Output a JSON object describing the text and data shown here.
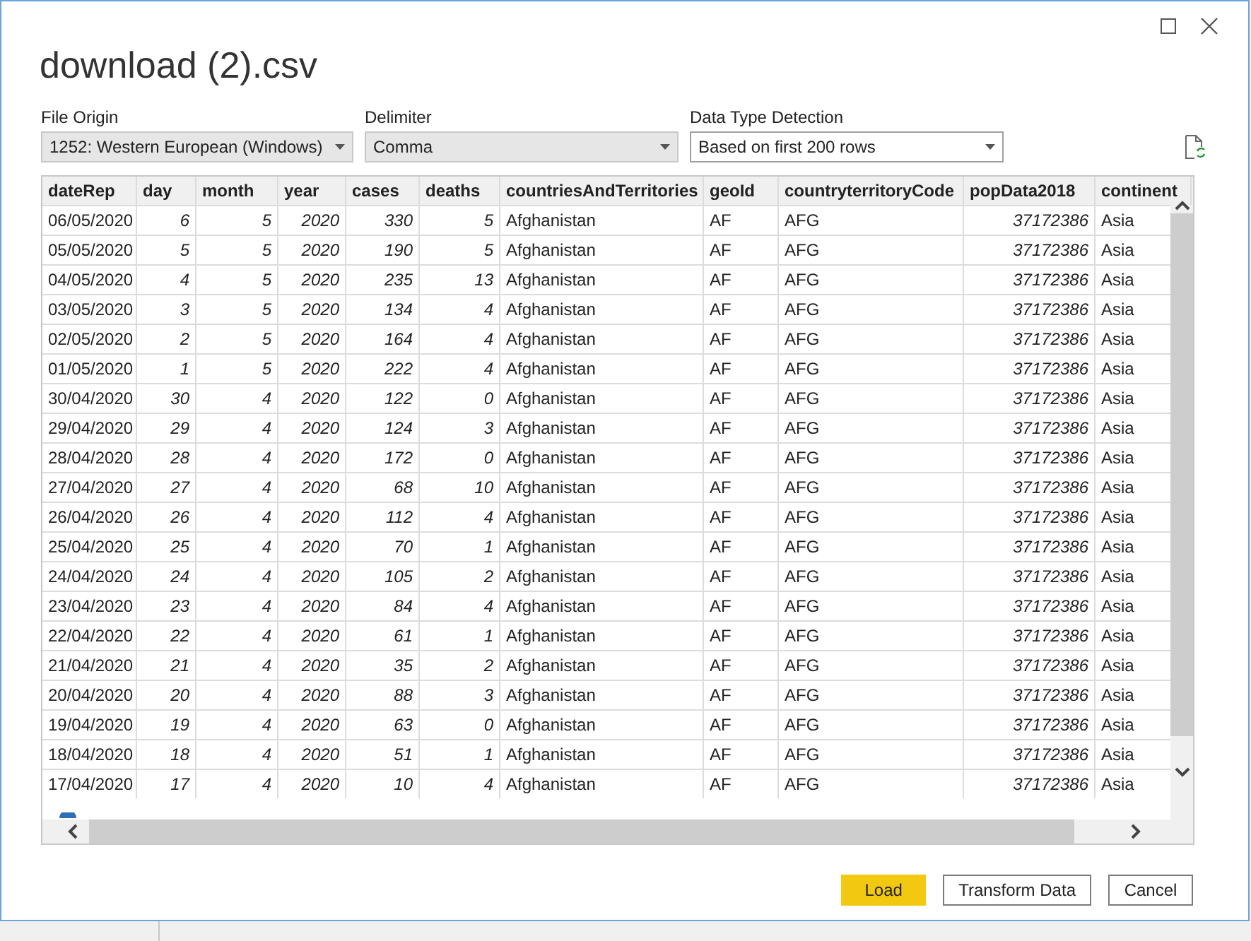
{
  "window": {
    "title": "download (2).csv"
  },
  "options": [
    {
      "label": "File Origin",
      "value": "1252: Western European (Windows)",
      "kind": "filled"
    },
    {
      "label": "Delimiter",
      "value": "Comma",
      "kind": "filled"
    },
    {
      "label": "Data Type Detection",
      "value": "Based on first 200 rows",
      "kind": "outlined"
    }
  ],
  "table": {
    "columns": [
      {
        "name": "dateRep",
        "kind": "text"
      },
      {
        "name": "day",
        "kind": "number"
      },
      {
        "name": "month",
        "kind": "number"
      },
      {
        "name": "year",
        "kind": "number"
      },
      {
        "name": "cases",
        "kind": "number"
      },
      {
        "name": "deaths",
        "kind": "number"
      },
      {
        "name": "countriesAndTerritories",
        "kind": "text"
      },
      {
        "name": "geoId",
        "kind": "text"
      },
      {
        "name": "countryterritoryCode",
        "kind": "text"
      },
      {
        "name": "popData2018",
        "kind": "number"
      },
      {
        "name": "continent",
        "kind": "text"
      }
    ],
    "rows": [
      [
        "06/05/2020",
        "6",
        "5",
        "2020",
        "330",
        "5",
        "Afghanistan",
        "AF",
        "AFG",
        "37172386",
        "Asia"
      ],
      [
        "05/05/2020",
        "5",
        "5",
        "2020",
        "190",
        "5",
        "Afghanistan",
        "AF",
        "AFG",
        "37172386",
        "Asia"
      ],
      [
        "04/05/2020",
        "4",
        "5",
        "2020",
        "235",
        "13",
        "Afghanistan",
        "AF",
        "AFG",
        "37172386",
        "Asia"
      ],
      [
        "03/05/2020",
        "3",
        "5",
        "2020",
        "134",
        "4",
        "Afghanistan",
        "AF",
        "AFG",
        "37172386",
        "Asia"
      ],
      [
        "02/05/2020",
        "2",
        "5",
        "2020",
        "164",
        "4",
        "Afghanistan",
        "AF",
        "AFG",
        "37172386",
        "Asia"
      ],
      [
        "01/05/2020",
        "1",
        "5",
        "2020",
        "222",
        "4",
        "Afghanistan",
        "AF",
        "AFG",
        "37172386",
        "Asia"
      ],
      [
        "30/04/2020",
        "30",
        "4",
        "2020",
        "122",
        "0",
        "Afghanistan",
        "AF",
        "AFG",
        "37172386",
        "Asia"
      ],
      [
        "29/04/2020",
        "29",
        "4",
        "2020",
        "124",
        "3",
        "Afghanistan",
        "AF",
        "AFG",
        "37172386",
        "Asia"
      ],
      [
        "28/04/2020",
        "28",
        "4",
        "2020",
        "172",
        "0",
        "Afghanistan",
        "AF",
        "AFG",
        "37172386",
        "Asia"
      ],
      [
        "27/04/2020",
        "27",
        "4",
        "2020",
        "68",
        "10",
        "Afghanistan",
        "AF",
        "AFG",
        "37172386",
        "Asia"
      ],
      [
        "26/04/2020",
        "26",
        "4",
        "2020",
        "112",
        "4",
        "Afghanistan",
        "AF",
        "AFG",
        "37172386",
        "Asia"
      ],
      [
        "25/04/2020",
        "25",
        "4",
        "2020",
        "70",
        "1",
        "Afghanistan",
        "AF",
        "AFG",
        "37172386",
        "Asia"
      ],
      [
        "24/04/2020",
        "24",
        "4",
        "2020",
        "105",
        "2",
        "Afghanistan",
        "AF",
        "AFG",
        "37172386",
        "Asia"
      ],
      [
        "23/04/2020",
        "23",
        "4",
        "2020",
        "84",
        "4",
        "Afghanistan",
        "AF",
        "AFG",
        "37172386",
        "Asia"
      ],
      [
        "22/04/2020",
        "22",
        "4",
        "2020",
        "61",
        "1",
        "Afghanistan",
        "AF",
        "AFG",
        "37172386",
        "Asia"
      ],
      [
        "21/04/2020",
        "21",
        "4",
        "2020",
        "35",
        "2",
        "Afghanistan",
        "AF",
        "AFG",
        "37172386",
        "Asia"
      ],
      [
        "20/04/2020",
        "20",
        "4",
        "2020",
        "88",
        "3",
        "Afghanistan",
        "AF",
        "AFG",
        "37172386",
        "Asia"
      ],
      [
        "19/04/2020",
        "19",
        "4",
        "2020",
        "63",
        "0",
        "Afghanistan",
        "AF",
        "AFG",
        "37172386",
        "Asia"
      ],
      [
        "18/04/2020",
        "18",
        "4",
        "2020",
        "51",
        "1",
        "Afghanistan",
        "AF",
        "AFG",
        "37172386",
        "Asia"
      ],
      [
        "17/04/2020",
        "17",
        "4",
        "2020",
        "10",
        "4",
        "Afghanistan",
        "AF",
        "AFG",
        "37172386",
        "Asia"
      ]
    ]
  },
  "buttons": [
    {
      "label": "Load",
      "kind": "primary"
    },
    {
      "label": "Transform Data",
      "kind": "secondary"
    },
    {
      "label": "Cancel",
      "kind": "secondary"
    }
  ]
}
